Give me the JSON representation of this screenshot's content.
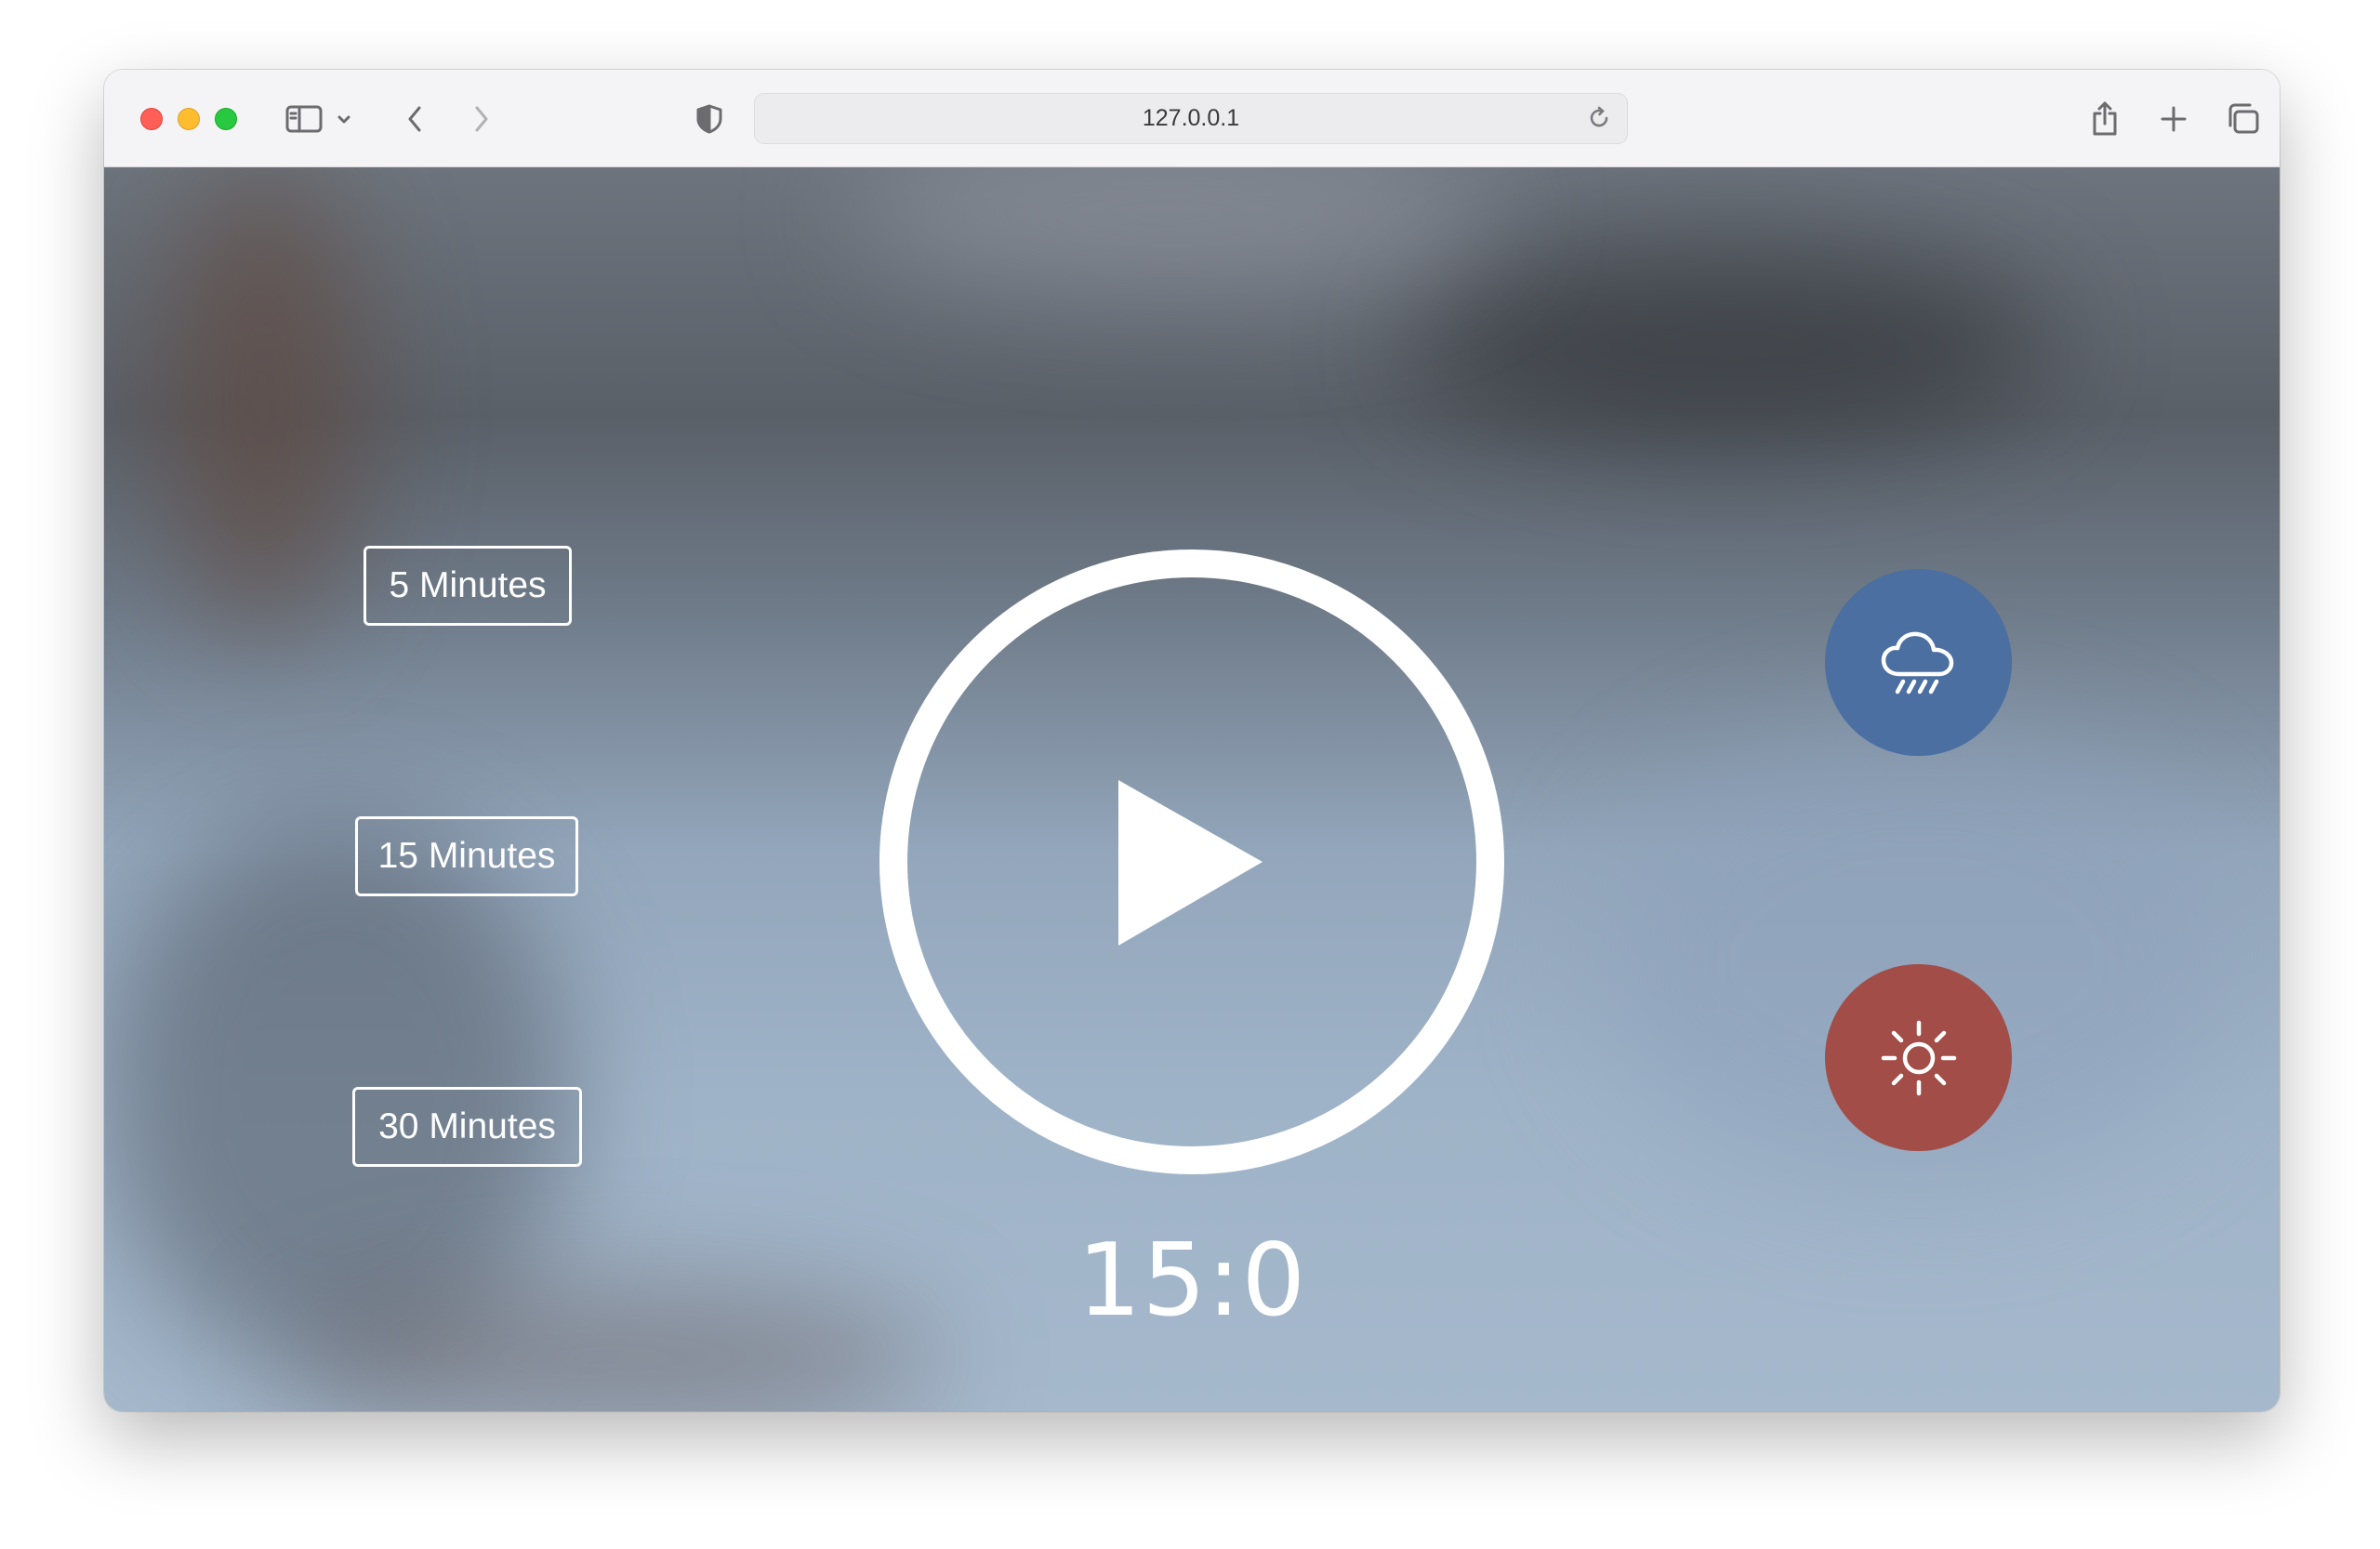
{
  "browser": {
    "url": "127.0.0.1",
    "icons": {
      "sidebar": "sidebar-icon",
      "chevron": "chevron-down-icon",
      "back": "back-arrow-icon",
      "forward": "forward-arrow-icon",
      "shield": "shield-icon",
      "reload": "reload-icon",
      "share": "share-icon",
      "new_tab": "plus-icon",
      "tabs": "tabs-overview-icon"
    }
  },
  "app": {
    "durations": [
      "5 Minutes",
      "15 Minutes",
      "30 Minutes"
    ],
    "timer": "15:0",
    "play_icon": "play-icon",
    "sounds": [
      {
        "name": "rain",
        "icon": "cloud-rain-icon",
        "color": "#4a6fa0"
      },
      {
        "name": "sun",
        "icon": "sun-icon",
        "color": "#a24d47"
      }
    ]
  }
}
